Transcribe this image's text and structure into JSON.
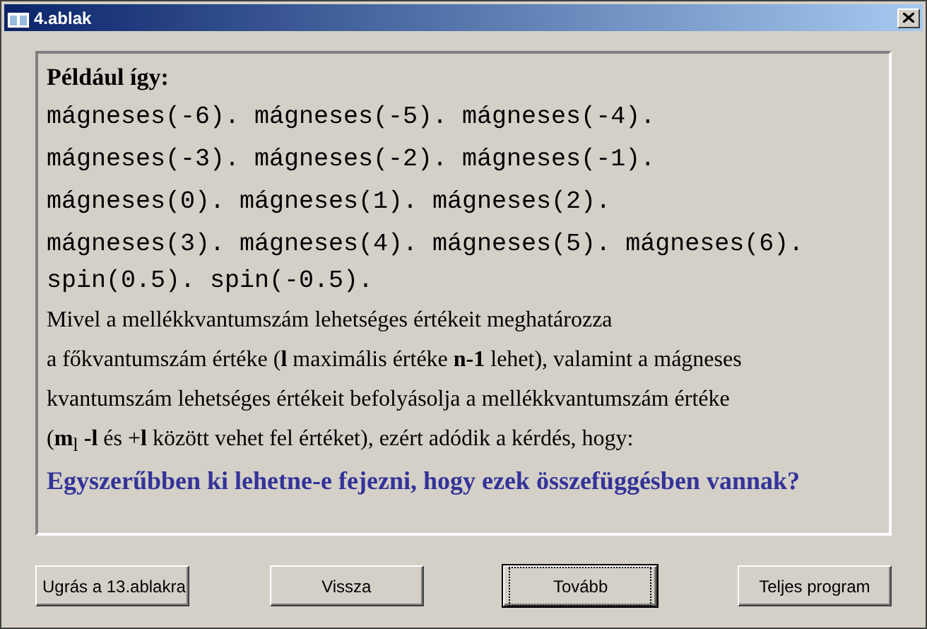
{
  "window": {
    "title": "4.ablak"
  },
  "heading": "Például így:",
  "code_lines": [
    "mágneses(-6). mágneses(-5). mágneses(-4).",
    "mágneses(-3). mágneses(-2). mágneses(-1).",
    "mágneses(0). mágneses(1). mágneses(2).",
    "mágneses(3). mágneses(4). mágneses(5). mágneses(6).",
    "spin(0.5). spin(-0.5)."
  ],
  "text_lines": [
    "Mivel a mellékkvantumszám lehetséges értékeit meghatározza",
    "a főkvantumszám értéke (**l** maximális értéke **n-1** lehet), valamint a mágneses",
    "kvantumszám lehetséges értékeit befolyásolja a mellékkvantumszám értéke",
    "(**m**$_{l}$ **-l** és +**l** között vehet fel értéket), ezért adódik a kérdés, hogy:"
  ],
  "question": "Egyszerűbben ki lehetne-e fejezni, hogy ezek összefüggésben vannak?",
  "buttons": [
    {
      "label": "Ugrás a 13.ablakra",
      "focused": false
    },
    {
      "label": "Vissza",
      "focused": false
    },
    {
      "label": "Tovább",
      "focused": true
    },
    {
      "label": "Teljes program",
      "focused": false
    }
  ]
}
